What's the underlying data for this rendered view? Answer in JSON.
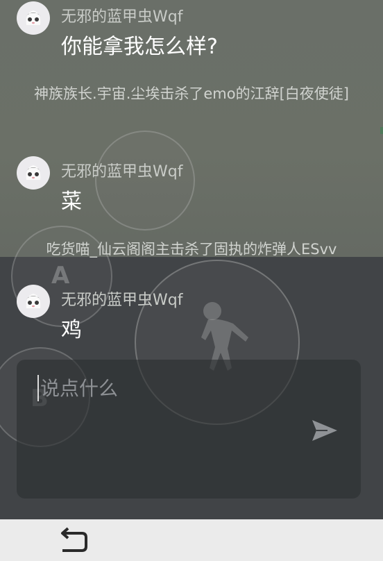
{
  "messages": [
    {
      "username": "无邪的蓝甲虫Wqf",
      "text": "你能拿我怎么样?"
    },
    {
      "username": "无邪的蓝甲虫Wqf",
      "text": "菜"
    },
    {
      "username": "无邪的蓝甲虫Wqf",
      "text": "鸡"
    }
  ],
  "system_messages": [
    "神族族长.宇宙.尘埃击杀了emo的江辞[白夜使徒]",
    "吃货喵_仙云阁阁主击杀了固执的炸弹人ESvv"
  ],
  "controls": {
    "button_a_label": "A",
    "button_b_label": "B"
  },
  "input": {
    "placeholder": "说点什么",
    "value": ""
  },
  "icons": {
    "avatar": "avatar-icon",
    "send": "send-icon",
    "back": "back-icon",
    "runner": "running-figure-icon"
  }
}
